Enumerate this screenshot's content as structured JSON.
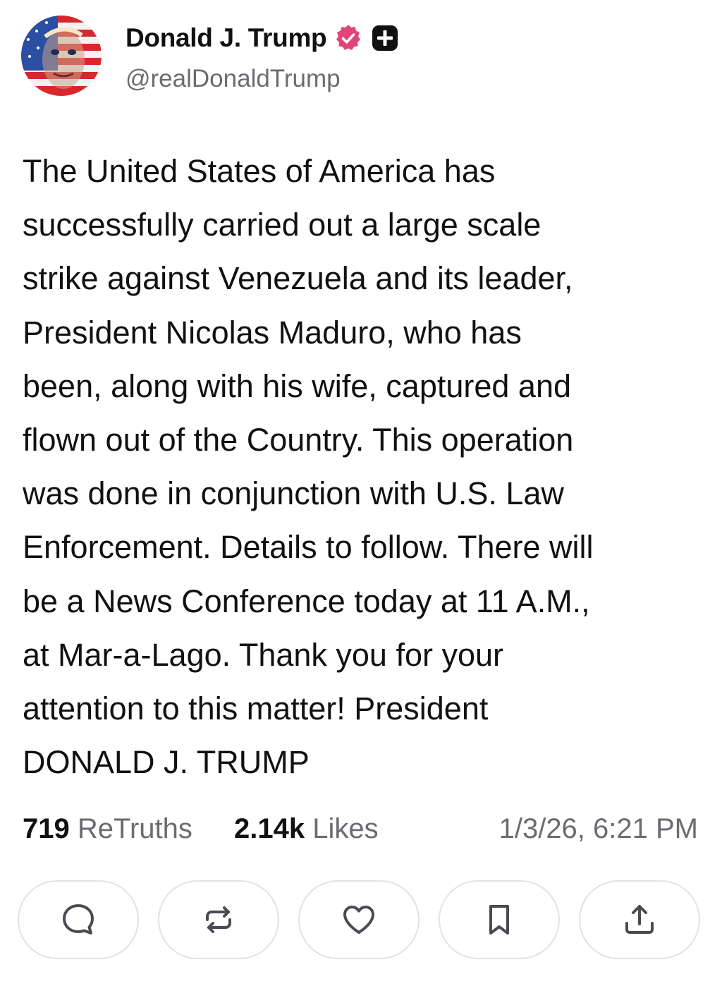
{
  "author": {
    "display_name": "Donald J. Trump",
    "handle": "@realDonaldTrump",
    "avatar_icon": "avatar-flag-portrait",
    "verified_icon": "verified-badge-icon",
    "plus_icon": "truth-plus-icon"
  },
  "post": {
    "text": "The United States of America has successfully carried out a large scale strike against Venezuela and its leader, President Nicolas Maduro, who has been, along with his wife, captured and flown out of the Country. This operation was done in conjunction with U.S. Law Enforcement. Details to follow. There will be a News Conference today at 11 A.M., at Mar-a-Lago. Thank you for your attention to this matter! President DONALD J. TRUMP",
    "text_lines": [
      "The United States of America has",
      "successfully carried out a large scale",
      "strike against Venezuela and its leader,",
      "President Nicolas Maduro, who has",
      "been, along with his wife, captured and",
      "flown out of the Country. This operation",
      "was done in conjunction with U.S. Law",
      "Enforcement. Details to follow. There will",
      "be a News Conference today at 11 A.M.,",
      "at Mar-a-Lago. Thank you for your",
      "attention to this matter! President",
      "DONALD J. TRUMP"
    ]
  },
  "stats": {
    "retruths_count": "719",
    "retruths_label": "ReTruths",
    "likes_count": "2.14k",
    "likes_label": "Likes",
    "timestamp": "1/3/26, 6:21 PM"
  },
  "actions": [
    {
      "icon": "reply-icon"
    },
    {
      "icon": "retruth-icon"
    },
    {
      "icon": "like-icon"
    },
    {
      "icon": "bookmark-icon"
    },
    {
      "icon": "share-icon"
    }
  ],
  "colors": {
    "text": "#111111",
    "muted": "#6b6b70",
    "border": "#e2e2e6",
    "verified": "#e0447a"
  }
}
